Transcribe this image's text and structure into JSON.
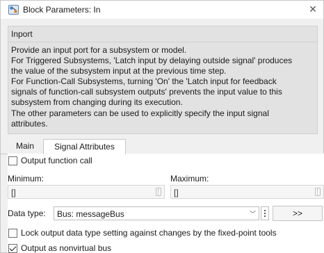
{
  "window": {
    "title": "Block Parameters: In",
    "icon": "simulink-block-icon",
    "close_icon": "close-icon"
  },
  "description": {
    "group_title": "Inport",
    "lines": [
      "Provide an input port for a subsystem or model.",
      "For Triggered Subsystems, 'Latch input by delaying outside signal' produces",
      "the value of the subsystem input at the previous time step.",
      "For Function-Call Subsystems, turning 'On' the 'Latch input for feedback",
      "signals of function-call subsystem outputs' prevents the input value to this",
      "subsystem from changing during its execution.",
      "The other parameters can be used to explicitly specify the input signal",
      "attributes."
    ]
  },
  "tabs": [
    {
      "label": "Main",
      "active": false
    },
    {
      "label": "Signal Attributes",
      "active": true
    }
  ],
  "signal_attributes": {
    "output_function_call": {
      "label": "Output function call",
      "checked": false
    },
    "minimum": {
      "label": "Minimum:",
      "value": "[]"
    },
    "maximum": {
      "label": "Maximum:",
      "value": "[]"
    },
    "data_type": {
      "label": "Data type:",
      "value": "Bus: messageBus",
      "more_button": ">>"
    },
    "lock_output": {
      "label": "Lock output data type setting against changes by the fixed-point tools",
      "checked": false
    },
    "output_nonvirtual_bus": {
      "label": "Output as nonvirtual bus",
      "checked": true
    }
  }
}
